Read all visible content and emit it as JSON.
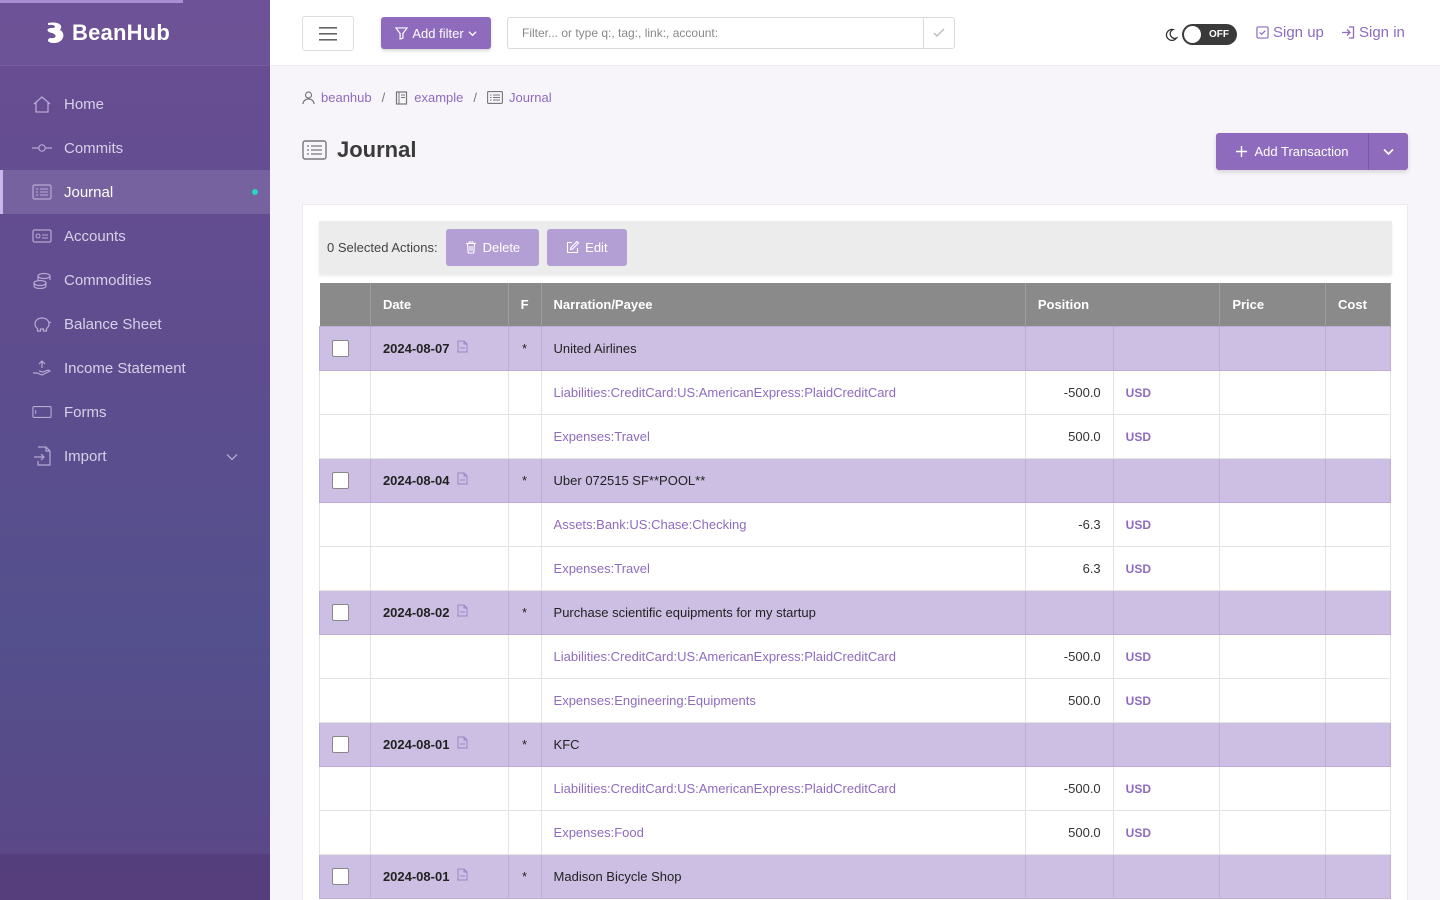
{
  "app": {
    "brand": "BeanHub"
  },
  "sidebar": {
    "items": [
      {
        "label": "Home",
        "icon": "home-icon"
      },
      {
        "label": "Commits",
        "icon": "commit-icon"
      },
      {
        "label": "Journal",
        "icon": "journal-icon",
        "active": true
      },
      {
        "label": "Accounts",
        "icon": "accounts-icon"
      },
      {
        "label": "Commodities",
        "icon": "coins-icon"
      },
      {
        "label": "Balance Sheet",
        "icon": "piggy-bank-icon"
      },
      {
        "label": "Income Statement",
        "icon": "income-icon"
      },
      {
        "label": "Forms",
        "icon": "form-icon"
      },
      {
        "label": "Import",
        "icon": "import-icon",
        "expandable": true
      }
    ]
  },
  "header": {
    "add_filter": "Add filter",
    "filter_placeholder": "Filter... or type q:, tag:, link:, account:",
    "theme_toggle": "OFF",
    "sign_up": "Sign up",
    "sign_in": "Sign in"
  },
  "breadcrumb": [
    "beanhub",
    "example",
    "Journal"
  ],
  "page": {
    "title": "Journal",
    "add_transaction": "Add Transaction"
  },
  "actions": {
    "selected": "0 Selected Actions:",
    "delete": "Delete",
    "edit": "Edit"
  },
  "table": {
    "headers": [
      "",
      "Date",
      "F",
      "Narration/Payee",
      "Position",
      "Price",
      "Cost"
    ],
    "rows": [
      {
        "type": "txn",
        "date": "2024-08-07",
        "flag": "*",
        "narration": "United Airlines"
      },
      {
        "type": "post",
        "account": "Liabilities:CreditCard:US:AmericanExpress:PlaidCreditCard",
        "amount": "-500.0",
        "currency": "USD"
      },
      {
        "type": "post",
        "account": "Expenses:Travel",
        "amount": "500.0",
        "currency": "USD"
      },
      {
        "type": "txn",
        "date": "2024-08-04",
        "flag": "*",
        "narration": "Uber 072515 SF**POOL**"
      },
      {
        "type": "post",
        "account": "Assets:Bank:US:Chase:Checking",
        "amount": "-6.3",
        "currency": "USD"
      },
      {
        "type": "post",
        "account": "Expenses:Travel",
        "amount": "6.3",
        "currency": "USD"
      },
      {
        "type": "txn",
        "date": "2024-08-02",
        "flag": "*",
        "narration": "Purchase scientific equipments for my startup"
      },
      {
        "type": "post",
        "account": "Liabilities:CreditCard:US:AmericanExpress:PlaidCreditCard",
        "amount": "-500.0",
        "currency": "USD"
      },
      {
        "type": "post",
        "account": "Expenses:Engineering:Equipments",
        "amount": "500.0",
        "currency": "USD"
      },
      {
        "type": "txn",
        "date": "2024-08-01",
        "flag": "*",
        "narration": "KFC"
      },
      {
        "type": "post",
        "account": "Liabilities:CreditCard:US:AmericanExpress:PlaidCreditCard",
        "amount": "-500.0",
        "currency": "USD"
      },
      {
        "type": "post",
        "account": "Expenses:Food",
        "amount": "500.0",
        "currency": "USD"
      },
      {
        "type": "txn",
        "date": "2024-08-01",
        "flag": "*",
        "narration": "Madison Bicycle Shop"
      }
    ]
  },
  "colors": {
    "accent": "#8e6bbd",
    "txn_row": "#cdbfe3",
    "header_gray": "#8a8a8a"
  }
}
